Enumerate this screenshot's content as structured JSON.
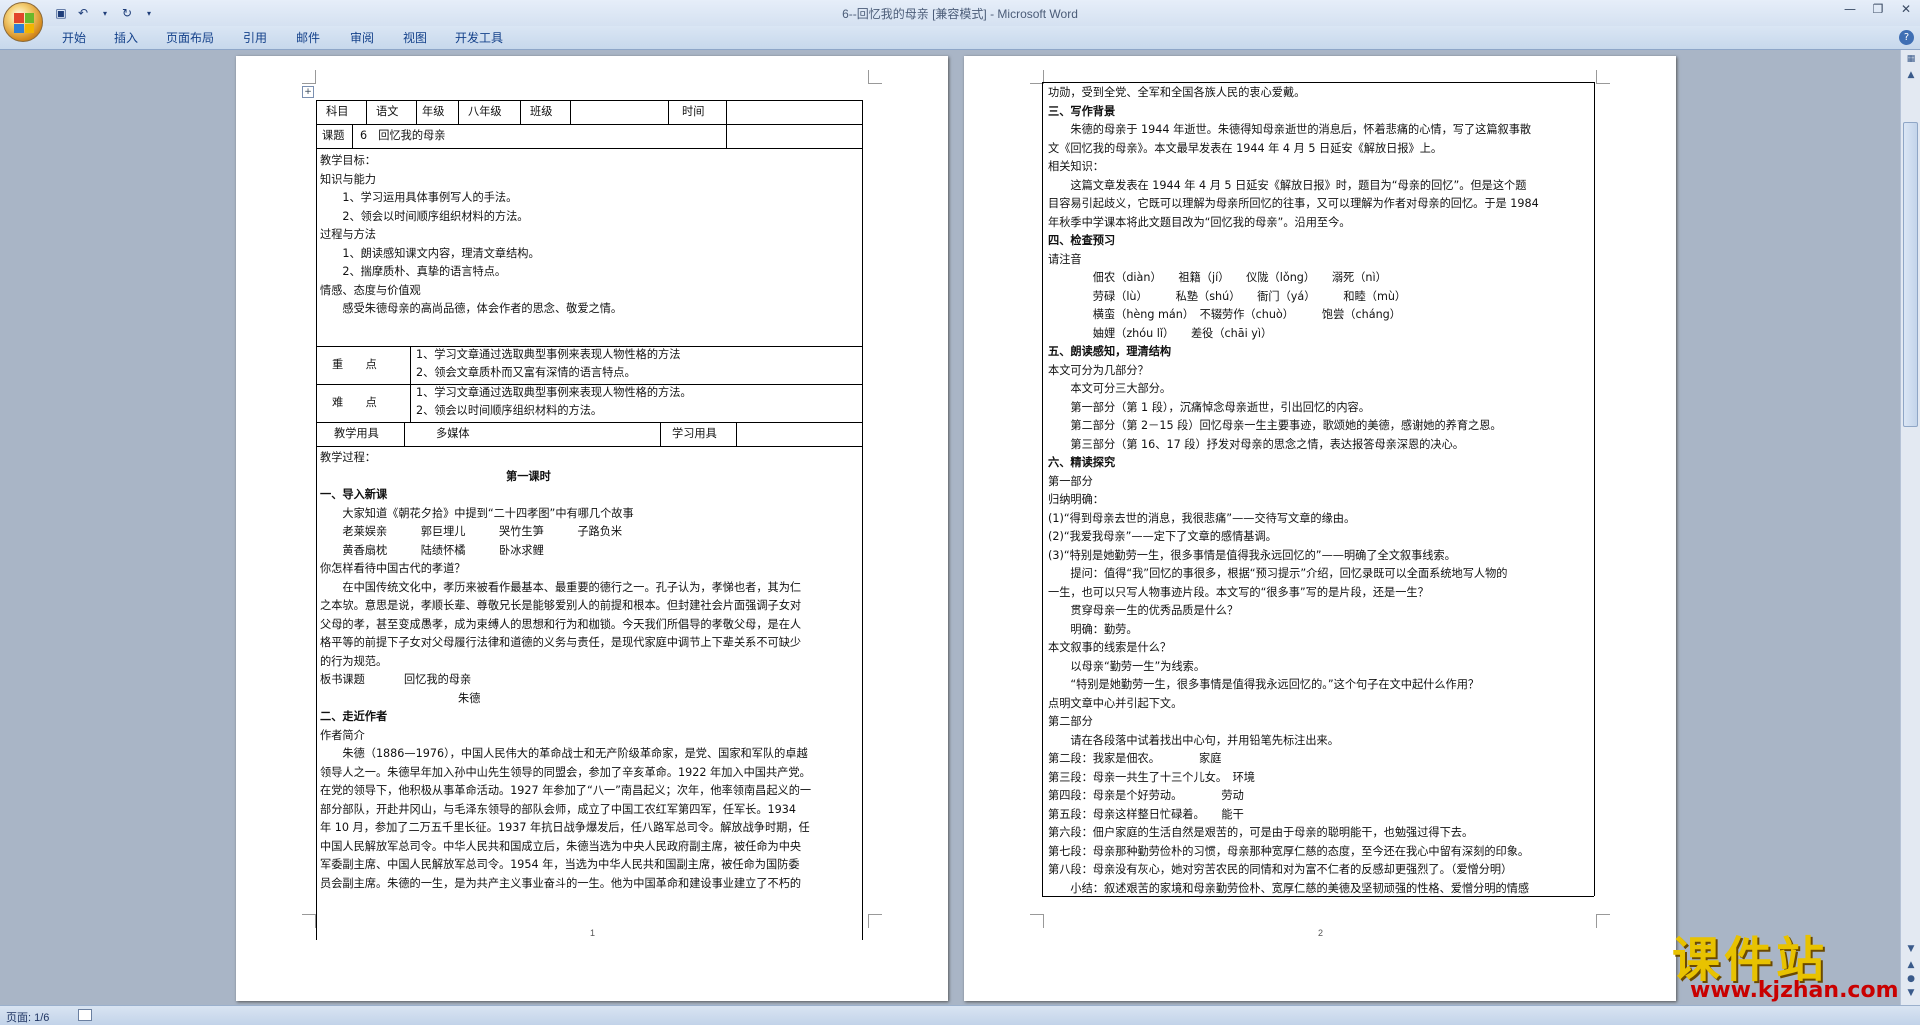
{
  "window": {
    "title": "6--回忆我的母亲 [兼容模式] - Microsoft Word"
  },
  "ribbon": {
    "tabs": [
      "开始",
      "插入",
      "页面布局",
      "引用",
      "邮件",
      "审阅",
      "视图",
      "开发工具"
    ]
  },
  "status": {
    "page": "页面: 1/6"
  },
  "page1": {
    "number": "1",
    "table": {
      "subject_label": "科目",
      "subject_value": "语文",
      "grade_label": "年级",
      "grade_value": "八年级",
      "class_label": "班级",
      "time_label": "时间",
      "topic_label": "课题",
      "topic_value": "6　回忆我的母亲",
      "key_label": "重　　点",
      "key_items": [
        "1、学习文章通过选取典型事例来表现人物性格的方法",
        "2、领会文章质朴而又富有深情的语言特点。"
      ],
      "difficult_label": "难　　点",
      "difficult_items": [
        "1、学习文章通过选取典型事例来表现人物性格的方法。",
        "2、领会以时间顺序组织材料的方法。"
      ],
      "tools_label": "教学用具",
      "tools_value": "多媒体",
      "study_tools_label": "学习用具"
    },
    "goals": [
      "教学目标：",
      "知识与能力",
      "　　1、学习运用具体事例写人的手法。",
      "　　2、领会以时间顺序组织材料的方法。",
      "过程与方法",
      "　　1、朗读感知课文内容，理清文章结构。",
      "　　2、揣摩质朴、真挚的语言特点。",
      "情感、态度与价值观",
      "　　感受朱德母亲的高尚品德，体会作者的思念、敬爱之情。"
    ],
    "process_label": "教学过程：",
    "lesson_title": "第一课时",
    "sec1": "一、导入新课",
    "intro": "　　大家知道《朝花夕拾》中提到“二十四孝图”中有哪几个故事",
    "stories1": "　　老莱娱亲　　　郭巨埋儿　　　哭竹生笋　　　子路负米",
    "stories2": "　　黄香扇枕　　　陆绩怀橘　　　卧冰求鲤",
    "question": "你怎样看待中国古代的孝道？",
    "para1": [
      "　　在中国传统文化中，孝历来被看作最基本、最重要的德行之一。孔子认为，孝悌也者，其为仁",
      "之本欤。意思是说，孝顺长辈、尊敬兄长是能够爱别人的前提和根本。但封建社会片面强调子女对",
      "父母的孝，甚至变成愚孝，成为束缚人的思想和行为和枷锁。今天我们所倡导的孝敬父母，是在人",
      "格平等的前提下子女对父母履行法律和道德的义务与责任，是现代家庭中调节上下辈关系不可缺少",
      "的行为规范。"
    ],
    "board_label": "板书课题",
    "board_title": "回忆我的母亲",
    "board_author": "朱德",
    "sec2": "二、走近作者",
    "author_intro": "作者简介",
    "para2": [
      "　　朱德（1886—1976），中国人民伟大的革命战士和无产阶级革命家，是党、国家和军队的卓越",
      "领导人之一。朱德早年加入孙中山先生领导的同盟会，参加了辛亥革命。1922 年加入中国共产党。",
      "在党的领导下，他积极从事革命活动。1927 年参加了“八一”南昌起义；次年，他率领南昌起义的一",
      "部分部队，开赴井冈山，与毛泽东领导的部队会师，成立了中国工农红军第四军，任军长。1934",
      "年 10 月，参加了二万五千里长征。1937 年抗日战争爆发后，任八路军总司令。解放战争时期，任",
      "中国人民解放军总司令。中华人民共和国成立后，朱德当选为中央人民政府副主席，被任命为中央",
      "军委副主席、中国人民解放军总司令。1954 年，当选为中华人民共和国副主席，被任命为国防委",
      "员会副主席。朱德的一生，是为共产主义事业奋斗的一生。他为中国革命和建设事业建立了不朽的"
    ]
  },
  "page2": {
    "number": "2",
    "lines": [
      "功勋，受到全党、全军和全国各族人民的衷心爱戴。",
      "三、写作背景",
      "　　朱德的母亲于 1944 年逝世。朱德得知母亲逝世的消息后，怀着悲痛的心情，写了这篇叙事散",
      "文《回忆我的母亲》。本文最早发表在 1944 年 4 月 5 日延安《解放日报》上。",
      "相关知识：",
      "　　这篇文章发表在 1944 年 4 月 5 日延安《解放日报》时，题目为“母亲的回忆”。但是这个题",
      "目容易引起歧义，它既可以理解为母亲所回忆的往事，又可以理解为作者对母亲的回忆。于是 1984",
      "年秋季中学课本将此文题目改为“回忆我的母亲”。沿用至今。",
      "四、检查预习",
      "请注音",
      "　　　　佃农（diàn）　　祖籍（jí）　　仪陇（lǒng）　　溺死（nì）",
      "　　　　劳碌（lù）　　　私塾（shú）　　衙门（yá）　　　和睦（mù）",
      "　　　　横蛮（hèng mán）　不辍劳作（chuò）　　　饱尝（cháng）",
      "　　　　妯娌（zhóu lǐ）　　差役（chāi yì）",
      "五、朗读感知，理清结构",
      "本文可分为几部分？",
      "　　本文可分三大部分。",
      "　　第一部分（第 1 段），沉痛悼念母亲逝世，引出回忆的内容。",
      "　　第二部分（第 2－15 段）回忆母亲一生主要事迹，歌颂她的美德，感谢她的养育之恩。",
      "　　第三部分（第 16、17 段）抒发对母亲的思念之情，表达报答母亲深恩的决心。",
      "六、精读探究",
      "第一部分",
      "归纳明确：",
      "(1)“得到母亲去世的消息，我很悲痛”——交待写文章的缘由。",
      "(2)“我爱我母亲”——定下了文章的感情基调。",
      "(3)“特别是她勤劳一生，很多事情是值得我永远回忆的”——明确了全文叙事线索。",
      "　　提问：值得“我”回忆的事很多，根据“预习提示”介绍，回忆录既可以全面系统地写人物的",
      "一生，也可以只写人物事迹片段。本文写的“很多事”写的是片段，还是一生？",
      "　　贯穿母亲一生的优秀品质是什么？",
      "　　明确：勤劳。",
      "本文叙事的线索是什么？",
      "　　以母亲“勤劳一生”为线索。",
      "　　“特别是她勤劳一生，很多事情是值得我永远回忆的。”这个句子在文中起什么作用？",
      "点明文章中心并引起下文。",
      "第二部分",
      "　　请在各段落中试着找出中心句，并用铅笔先标注出来。",
      "第二段：我家是佃农。　　　　家庭",
      "第三段：母亲一共生了十三个儿女。　环境",
      "第四段：母亲是个好劳动。　　　　劳动",
      "第五段：母亲这样整日忙碌着。　　能干",
      "第六段：佃户家庭的生活自然是艰苦的，可是由于母亲的聪明能干，也勉强过得下去。",
      "第七段：母亲那种勤劳俭朴的习惯，母亲那种宽厚仁慈的态度，至今还在我心中留有深刻的印象。",
      "第八段：母亲没有灰心，她对穷苦农民的同情和对为富不仁者的反感却更强烈了。（爱憎分明）",
      "　　小结：叙述艰苦的家境和母亲勤劳俭朴、宽厚仁慈的美德及坚韧顽强的性格、爱憎分明的情感"
    ]
  },
  "watermark": {
    "text": "课件站",
    "url": "www.kjzhan.com"
  }
}
